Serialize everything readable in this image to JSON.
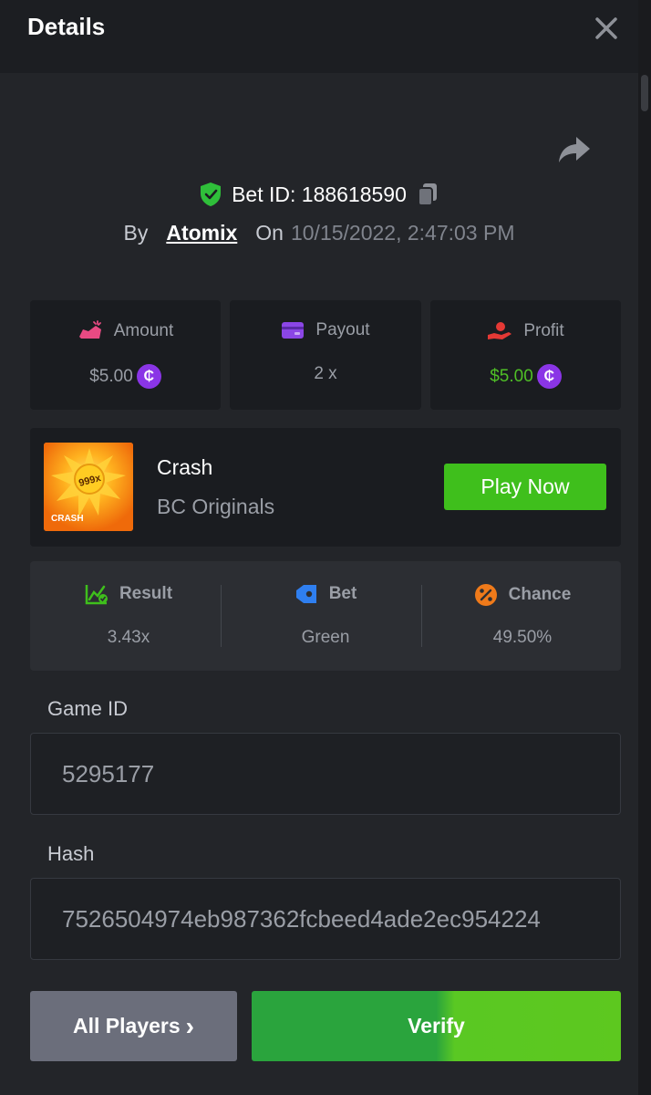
{
  "header": {
    "title": "Details"
  },
  "bet": {
    "id_text": "Bet ID: 188618590",
    "by_label": "By",
    "user": "Atomix",
    "on_label": "On",
    "date": "10/15/2022, 2:47:03 PM"
  },
  "stats": {
    "amount": {
      "label": "Amount",
      "value": "$5.00"
    },
    "payout": {
      "label": "Payout",
      "value": "2 x"
    },
    "profit": {
      "label": "Profit",
      "value": "$5.00"
    },
    "coin_symbol": "₵"
  },
  "game": {
    "thumb_multiplier": "999x",
    "thumb_label": "CRASH",
    "name": "Crash",
    "provider": "BC Originals",
    "play_label": "Play Now"
  },
  "result": {
    "result": {
      "label": "Result",
      "value": "3.43x"
    },
    "bet": {
      "label": "Bet",
      "value": "Green"
    },
    "chance": {
      "label": "Chance",
      "value": "49.50%"
    }
  },
  "fields": {
    "game_id": {
      "label": "Game ID",
      "value": "5295177"
    },
    "hash": {
      "label": "Hash",
      "value": "7526504974eb987362fcbeed4ade2ec954224"
    }
  },
  "actions": {
    "all_players": "All Players",
    "all_players_chevron": "›",
    "verify": "Verify"
  },
  "colors": {
    "accent_green": "#3fbf1c",
    "profit_green": "#4fbf26",
    "coin_purple": "#8a35e6",
    "shield_green": "#2fbf3a"
  }
}
